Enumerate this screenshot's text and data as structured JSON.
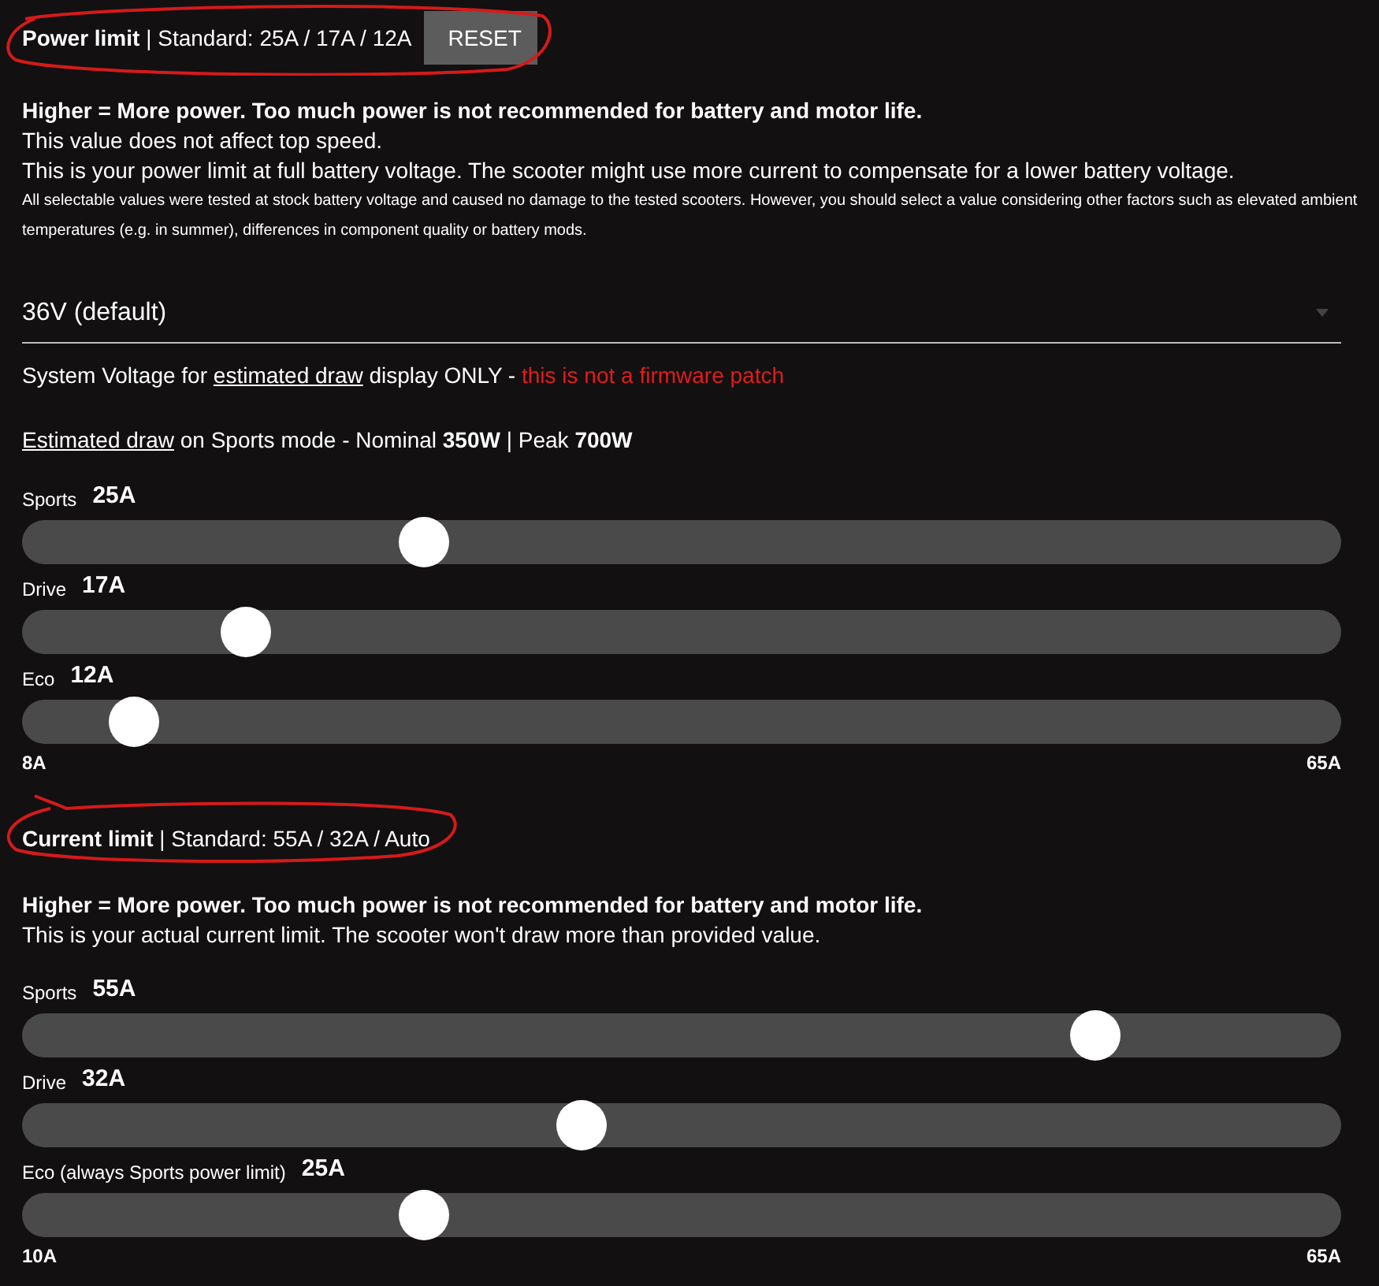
{
  "power_limit": {
    "title": "**Power limit** | Standard: 25A / 17A / 12A",
    "reset_button": "RESET",
    "notes": [
      {
        "kind": "bold",
        "text": "Higher = More power. Too much power is not recommended for battery and motor life."
      },
      {
        "kind": "normal",
        "text": "This value does not affect top speed."
      },
      {
        "kind": "normal",
        "text": "This is your power limit at full battery voltage. The scooter might use more current to compensate for a lower battery voltage."
      },
      {
        "kind": "small",
        "text": "All selectable values were tested at stock battery voltage and caused no damage to the tested scooters. However, you should select a value considering other factors such as elevated ambient temperatures (e.g. in summer), differences in component quality or battery mods."
      }
    ],
    "voltage_select": {
      "value": "36V (default)"
    },
    "voltage_note": [
      {
        "kind": "plain",
        "text": "System Voltage for "
      },
      {
        "kind": "underline",
        "text": "estimated draw"
      },
      {
        "kind": "plain",
        "text": " display ONLY - "
      },
      {
        "kind": "warning",
        "text": "this is not a firmware patch"
      }
    ],
    "estimate": [
      {
        "kind": "underline",
        "text": "Estimated draw"
      },
      {
        "kind": "plain",
        "text": " on Sports mode - Nominal "
      },
      {
        "kind": "bold",
        "text": "350W"
      },
      {
        "kind": "plain",
        "text": " | Peak "
      },
      {
        "kind": "bold",
        "text": "700W"
      }
    ],
    "sliders": [
      {
        "label": "Sports",
        "value": "25A",
        "level": 0.297
      },
      {
        "label": "Drive",
        "value": "17A",
        "level": 0.157
      },
      {
        "label": "Eco",
        "value": "12A",
        "level": 0.068
      }
    ],
    "range": {
      "min": "8A",
      "max": "65A"
    }
  },
  "current_limit": {
    "title": "**Current limit** | Standard: 55A / 32A / Auto",
    "notes": [
      {
        "kind": "bold",
        "text": "Higher = More power. Too much power is not recommended for battery and motor life."
      },
      {
        "kind": "normal",
        "text": "This is your actual current limit. The scooter won't draw more than provided value."
      }
    ],
    "sliders": [
      {
        "label": "Sports",
        "value": "55A",
        "level": 0.826
      },
      {
        "label": "Drive",
        "value": "32A",
        "level": 0.421
      },
      {
        "label": "Eco (always Sports power limit)",
        "value": "25A",
        "level": 0.297
      }
    ],
    "range": {
      "min": "10A",
      "max": "65A"
    }
  }
}
